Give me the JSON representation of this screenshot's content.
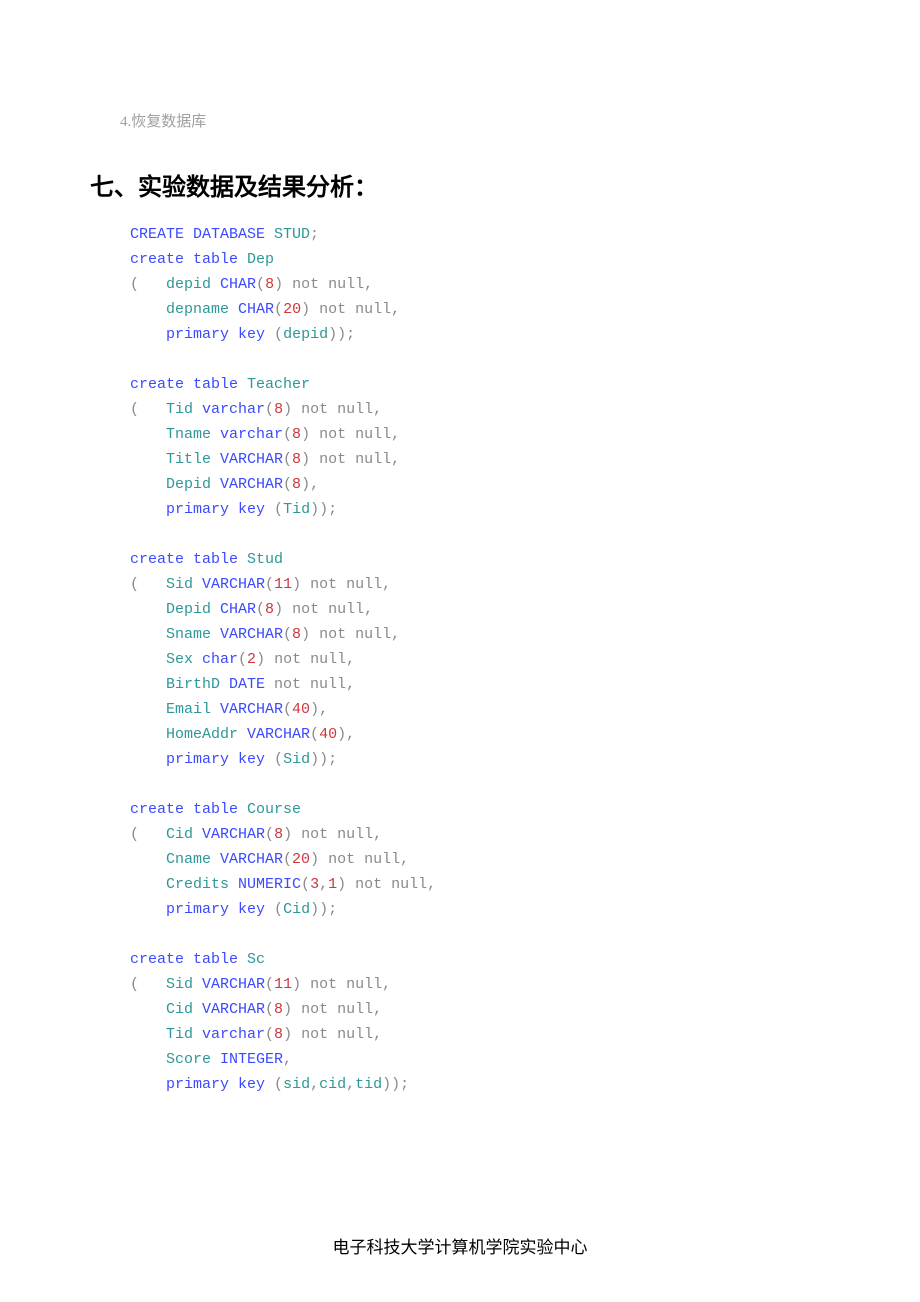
{
  "topnote": {
    "number": "4.",
    "text": "恢复数据库"
  },
  "heading": "七、实验数据及结果分析：",
  "code": {
    "l1a": "CREATE",
    "l1b": " DATABASE",
    "l1c": " STUD",
    "l2a": "create",
    "l2b": " table",
    "l2c": " Dep",
    "l3a": "(   ",
    "l3b": "depid",
    "l3c": " CHAR",
    "l3d": "(",
    "l3e": "8",
    "l3f": ")",
    "l3g": " not",
    "l3h": " null",
    "l4a": "    depname",
    "l4b": " CHAR",
    "l4c": "(",
    "l4d": "20",
    "l4e": ")",
    "l4f": " not",
    "l4g": " null",
    "l5a": "    ",
    "l5b": "primary",
    "l5c": " key",
    "l5d": " (",
    "l5e": "depid",
    "l5f": "));",
    "l7a": "create",
    "l7b": " table",
    "l7c": " Teacher",
    "l8a": "(   ",
    "l8b": "Tid",
    "l8c": " varchar",
    "l8d": "(",
    "l8e": "8",
    "l8f": ")",
    "l8g": " not",
    "l8h": " null",
    "l9a": "    Tname",
    "l9b": " varchar",
    "l9c": "(",
    "l9d": "8",
    "l9e": ")",
    "l9f": " not",
    "l9g": " null",
    "l10a": "    Title",
    "l10b": " VARCHAR",
    "l10c": "(",
    "l10d": "8",
    "l10e": ")",
    "l10f": " not",
    "l10g": " null",
    "l11a": "    Depid",
    "l11b": " VARCHAR",
    "l11c": "(",
    "l11d": "8",
    "l11e": "),",
    "l12a": "    ",
    "l12b": "primary",
    "l12c": " key",
    "l12d": " (",
    "l12e": "Tid",
    "l12f": "));",
    "l14a": "create",
    "l14b": " table",
    "l14c": " Stud",
    "l15a": "(   ",
    "l15b": "Sid",
    "l15c": " VARCHAR",
    "l15d": "(",
    "l15e": "11",
    "l15f": ")",
    "l15g": " not",
    "l15h": " null",
    "l16a": "    Depid",
    "l16b": " CHAR",
    "l16c": "(",
    "l16d": "8",
    "l16e": ")",
    "l16f": " not",
    "l16g": " null",
    "l17a": "    Sname",
    "l17b": " VARCHAR",
    "l17c": "(",
    "l17d": "8",
    "l17e": ")",
    "l17f": " not",
    "l17g": " null",
    "l18a": "    Sex",
    "l18b": " char",
    "l18c": "(",
    "l18d": "2",
    "l18e": ")",
    "l18f": " not",
    "l18g": " null",
    "l19a": "    BirthD",
    "l19b": " DATE",
    "l19c": " not",
    "l19d": " null",
    "l20a": "    Email",
    "l20b": " VARCHAR",
    "l20c": "(",
    "l20d": "40",
    "l20e": "),",
    "l21a": "    HomeAddr",
    "l21b": " VARCHAR",
    "l21c": "(",
    "l21d": "40",
    "l21e": "),",
    "l22a": "    ",
    "l22b": "primary",
    "l22c": " key",
    "l22d": " (",
    "l22e": "Sid",
    "l22f": "));",
    "l24a": "create",
    "l24b": " table",
    "l24c": " Course",
    "l25a": "(   ",
    "l25b": "Cid",
    "l25c": " VARCHAR",
    "l25d": "(",
    "l25e": "8",
    "l25f": ")",
    "l25g": " not",
    "l25h": " null",
    "l26a": "    Cname",
    "l26b": " VARCHAR",
    "l26c": "(",
    "l26d": "20",
    "l26e": ")",
    "l26f": " not",
    "l26g": " null",
    "l27a": "    Credits",
    "l27b": " NUMERIC",
    "l27c": "(",
    "l27d": "3",
    "l27e": ",",
    "l27f": "1",
    "l27g": ")",
    "l27h": " not",
    "l27i": " null",
    "l28a": "    ",
    "l28b": "primary",
    "l28c": " key",
    "l28d": " (",
    "l28e": "Cid",
    "l28f": "));",
    "l30a": "create",
    "l30b": " table",
    "l30c": " Sc",
    "l31a": "(   ",
    "l31b": "Sid",
    "l31c": " VARCHAR",
    "l31d": "(",
    "l31e": "11",
    "l31f": ")",
    "l31g": " not",
    "l31h": " null",
    "l32a": "    Cid",
    "l32b": " VARCHAR",
    "l32c": "(",
    "l32d": "8",
    "l32e": ")",
    "l32f": " not",
    "l32g": " null",
    "l33a": "    Tid",
    "l33b": " varchar",
    "l33c": "(",
    "l33d": "8",
    "l33e": ")",
    "l33f": " not",
    "l33g": " null",
    "l34a": "    Score",
    "l34b": " INTEGER",
    "l35a": "    ",
    "l35b": "primary",
    "l35c": " key",
    "l35d": " (",
    "l35e": "sid",
    "l35f": ",",
    "l35g": "cid",
    "l35h": ",",
    "l35i": "tid",
    "l35j": "));"
  },
  "footer": "电子科技大学计算机学院实验中心"
}
